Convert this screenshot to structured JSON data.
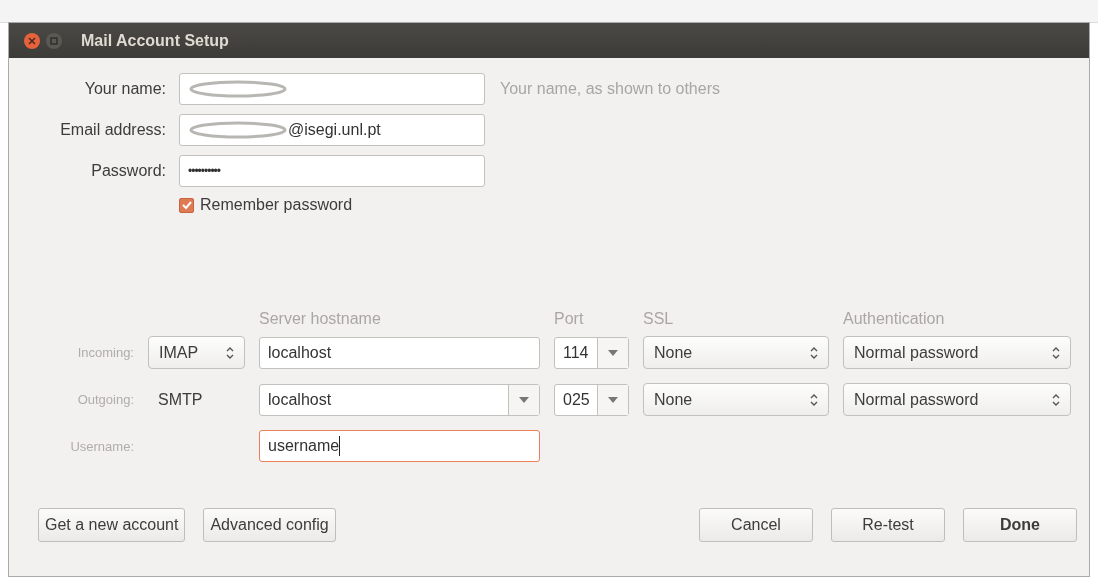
{
  "window": {
    "title": "Mail Account Setup"
  },
  "identity": [
    {
      "label": "Your name:",
      "redacted": true,
      "hint": "Your name, as shown to others"
    },
    {
      "label": "Email address:",
      "value": "@isegi.unl.pt",
      "redacted": true
    },
    {
      "label": "Password:",
      "value": "••••••••••",
      "redacted": false
    }
  ],
  "remember_password": {
    "label": "Remember password",
    "checked": true
  },
  "server_columns": [
    "Server hostname",
    "Port",
    "SSL",
    "Authentication"
  ],
  "servers": [
    {
      "label": "Incoming:",
      "protocol": {
        "text": "IMAP",
        "kind": "select"
      },
      "hostname": {
        "text": "localhost",
        "kind": "field"
      },
      "port": "114",
      "ssl": "None",
      "authentication": "Normal password"
    },
    {
      "label": "Outgoing:",
      "protocol": {
        "text": "SMTP",
        "kind": "text"
      },
      "hostname": {
        "text": "localhost",
        "kind": "combo"
      },
      "port": "025",
      "ssl": "None",
      "authentication": "Normal password"
    }
  ],
  "username": {
    "label": "Username:",
    "value": "username",
    "focused": true
  },
  "buttons": [
    {
      "label": "Get a new account",
      "kind": "left",
      "default": false
    },
    {
      "label": "Advanced config",
      "kind": "left",
      "default": false
    },
    {
      "label": "Cancel",
      "kind": "right",
      "default": false
    },
    {
      "label": "Re-test",
      "kind": "right",
      "default": false
    },
    {
      "label": "Done",
      "kind": "right",
      "default": true
    }
  ]
}
